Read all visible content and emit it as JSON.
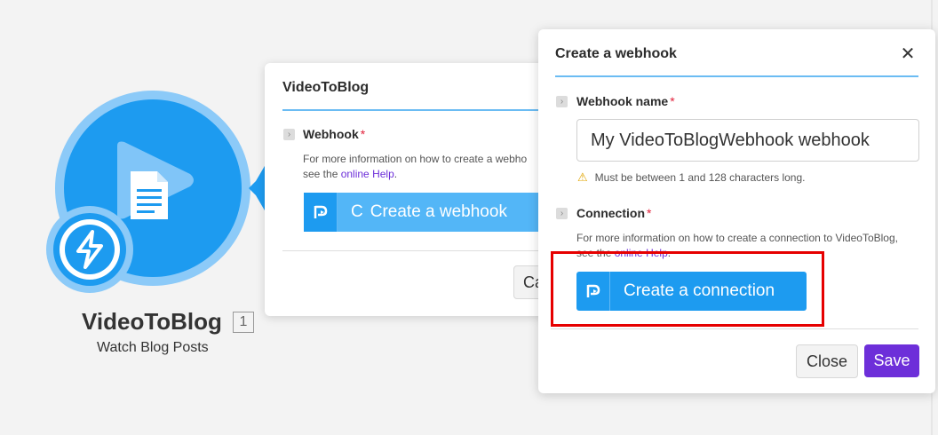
{
  "module": {
    "name": "VideoToBlog",
    "badge": "1",
    "subtitle": "Watch Blog Posts",
    "icons": [
      "video-play-icon",
      "document-icon",
      "lightning-bolt-icon"
    ]
  },
  "dialog_back": {
    "title": "VideoToBlog",
    "field_label": "Webhook",
    "required_mark": "*",
    "help_line1": "For more information on how to create a webho",
    "help_prefix": "see the ",
    "help_link": "online Help",
    "help_suffix": ".",
    "create_button_label": "Create a webhook",
    "cancel_label_partial": "Ca"
  },
  "dialog_front": {
    "title": "Create a webhook",
    "webhook_name_label": "Webhook name",
    "required_mark": "*",
    "webhook_name_value": "My VideoToBlogWebhook webhook",
    "validation_text": "Must be between 1 and 128 characters long.",
    "connection_label": "Connection",
    "connection_help_line1": "For more information on how to create a connection to VideoToBlog,",
    "connection_help_prefix": "see the ",
    "connection_help_link": "online Help",
    "connection_help_suffix": ".",
    "create_connection_label": "Create a connection",
    "close_label": "Close",
    "save_label": "Save"
  },
  "colors": {
    "brand_blue": "#1d9bf0",
    "light_blue": "#8ccaf8",
    "primary_purple": "#6d2fd9",
    "highlight_red": "#e60000"
  }
}
